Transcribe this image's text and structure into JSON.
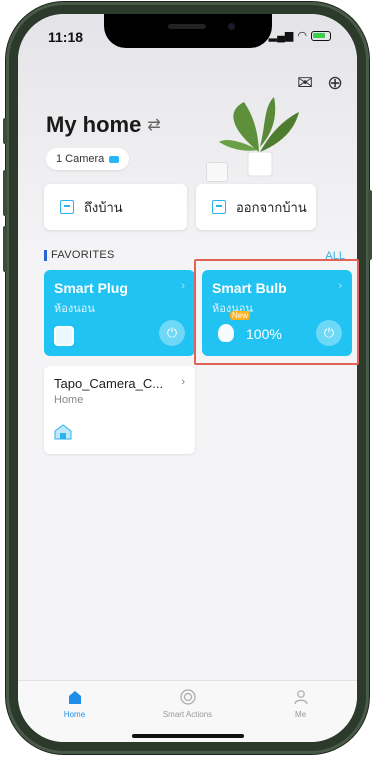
{
  "status_bar": {
    "time": "11:18",
    "colors": {
      "battery": "#3ccf4e"
    }
  },
  "header": {
    "title": "My home",
    "camera_chip": "1 Camera",
    "icons": [
      "mail-icon",
      "plus-circle-icon",
      "swap-icon"
    ]
  },
  "actions": [
    {
      "label": "ถึงบ้าน",
      "icon": "arrive-home-icon"
    },
    {
      "label": "ออกจากบ้าน",
      "icon": "leave-home-icon"
    }
  ],
  "favorites": {
    "heading": "FAVORITES",
    "all_label": "ALL",
    "devices": [
      {
        "name": "Smart Plug",
        "room": "ห้องนอน",
        "state": "on",
        "icon": "smart-plug-icon"
      },
      {
        "name": "Smart Bulb",
        "room": "ห้องนอน",
        "state": "on",
        "brightness": "100%",
        "badge": "New",
        "icon": "bulb-icon"
      },
      {
        "name": "Tapo_Camera_C...",
        "room": "Home",
        "state": "off",
        "icon": "camera-house-icon"
      }
    ]
  },
  "tabbar": {
    "items": [
      {
        "label": "Home",
        "active": true
      },
      {
        "label": "Smart Actions",
        "active": false
      },
      {
        "label": "Me",
        "active": false
      }
    ]
  },
  "colors": {
    "accent": "#21c3f3",
    "highlight": "#e2625a",
    "tab_active": "#1f8ee8"
  }
}
